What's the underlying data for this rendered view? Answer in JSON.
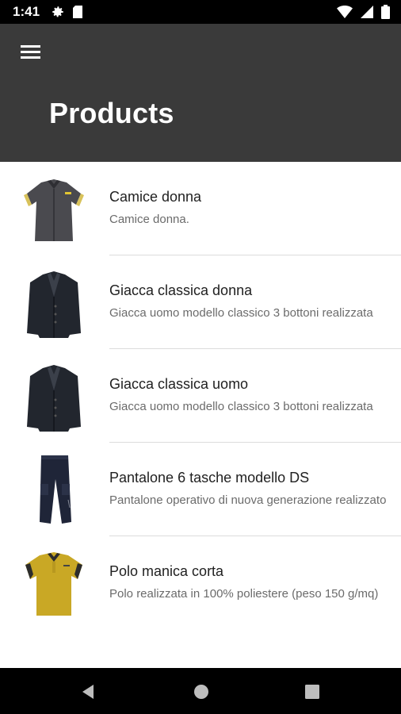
{
  "status": {
    "time": "1:41"
  },
  "header": {
    "title": "Products"
  },
  "products": [
    {
      "title": "Camice donna",
      "subtitle": "Camice donna."
    },
    {
      "title": "Giacca classica donna",
      "subtitle": "Giacca uomo modello classico 3 bottoni realizzata"
    },
    {
      "title": "Giacca classica uomo",
      "subtitle": "Giacca uomo modello classico 3 bottoni realizzata"
    },
    {
      "title": "Pantalone 6 tasche modello DS",
      "subtitle": "Pantalone operativo di nuova generazione realizzato"
    },
    {
      "title": "Polo manica corta",
      "subtitle": "Polo realizzata in 100% poliestere (peso 150 g/mq)"
    }
  ],
  "colors": {
    "appbar": "#3a3a3a",
    "accent_yellow": "#c9a825"
  }
}
